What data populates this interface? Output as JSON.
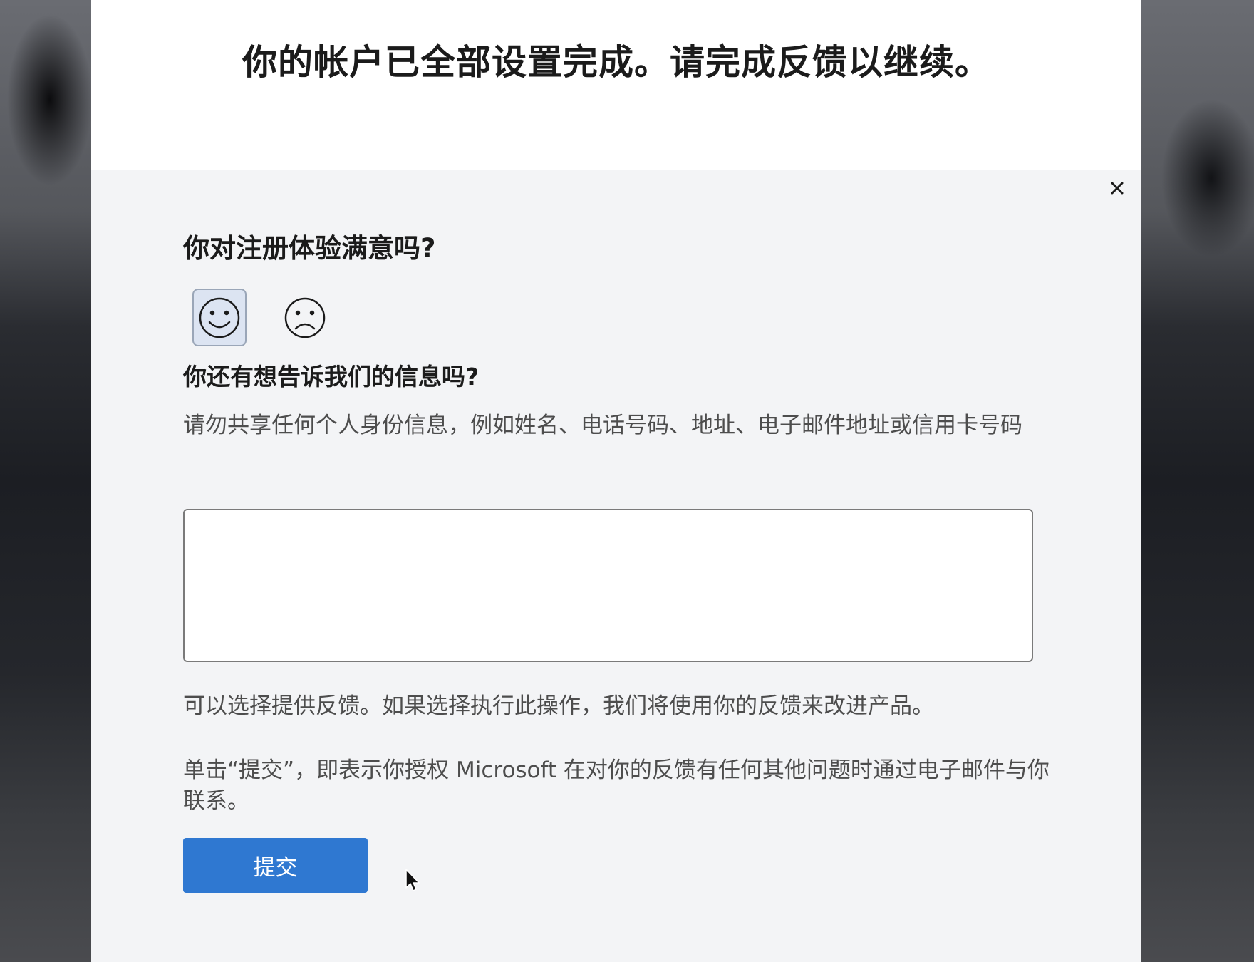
{
  "header": {
    "title": "你的帐户已全部设置完成。请完成反馈以继续。"
  },
  "survey": {
    "close_icon": "close-icon",
    "question_satisfaction": "你对注册体验满意吗?",
    "happy_icon": "smiley-face-icon",
    "sad_icon": "frowning-face-icon",
    "selected_rating": "happy",
    "question_more_info": "你还有想告诉我们的信息吗?",
    "privacy_note": "请勿共享任何个人身份信息，例如姓名、电话号码、地址、电子邮件地址或信用卡号码",
    "feedback_value": "",
    "optional_note": "可以选择提供反馈。如果选择执行此操作，我们将使用你的反馈来改进产品。",
    "consent_note": "单击“提交”，即表示你授权 Microsoft 在对你的反馈有任何其他问题时通过电子邮件与你联系。",
    "submit_label": "提交"
  },
  "colors": {
    "header_bg": "#ffffff",
    "panel_bg": "#f3f4f6",
    "primary_button": "#2f78d1",
    "selected_face_bg": "#dce4f2"
  }
}
